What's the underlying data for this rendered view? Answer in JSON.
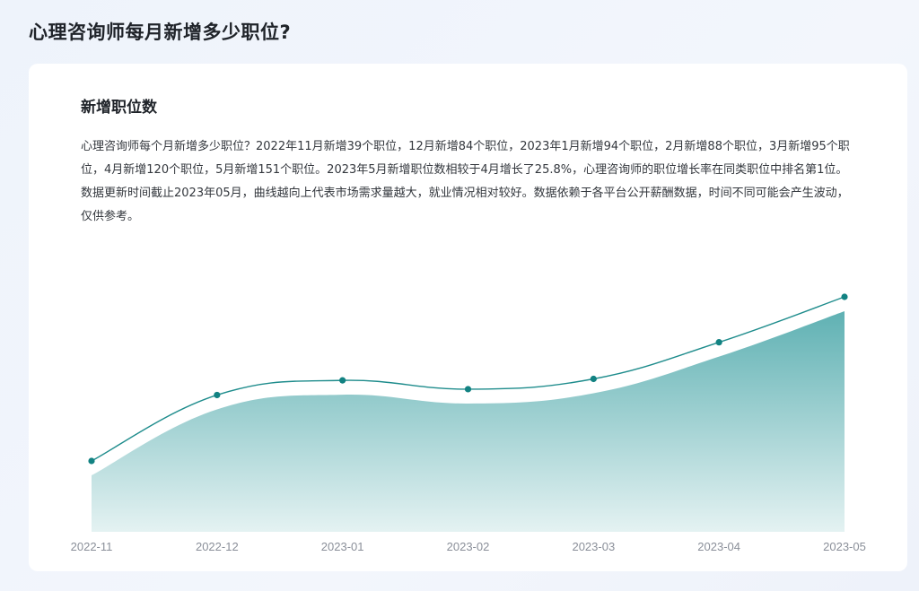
{
  "page_title": "心理咨询师每月新增多少职位?",
  "card": {
    "title": "新增职位数",
    "description": "心理咨询师每个月新增多少职位？2022年11月新增39个职位，12月新增84个职位，2023年1月新增94个职位，2月新增88个职位，3月新增95个职位，4月新增120个职位，5月新增151个职位。2023年5月新增职位数相较于4月增长了25.8%，心理咨询师的职位增长率在同类职位中排名第1位。数据更新时间截止2023年05月，曲线越向上代表市场需求量越大，就业情况相对较好。数据依赖于各平台公开薪酬数据，时间不同可能会产生波动，仅供参考。"
  },
  "colors": {
    "line": "#1e8c8c",
    "point": "#128282",
    "area_top": "#5fb1b3",
    "area_bottom": "#e4f2f2"
  },
  "chart_data": {
    "type": "area",
    "title": "新增职位数",
    "categories": [
      "2022-11",
      "2022-12",
      "2023-01",
      "2023-02",
      "2023-03",
      "2023-04",
      "2023-05"
    ],
    "series": [
      {
        "values": [
          39,
          84,
          94,
          88,
          95,
          120,
          151
        ]
      }
    ],
    "xlabel": "",
    "ylabel": "",
    "grid": false,
    "legend": "none"
  }
}
